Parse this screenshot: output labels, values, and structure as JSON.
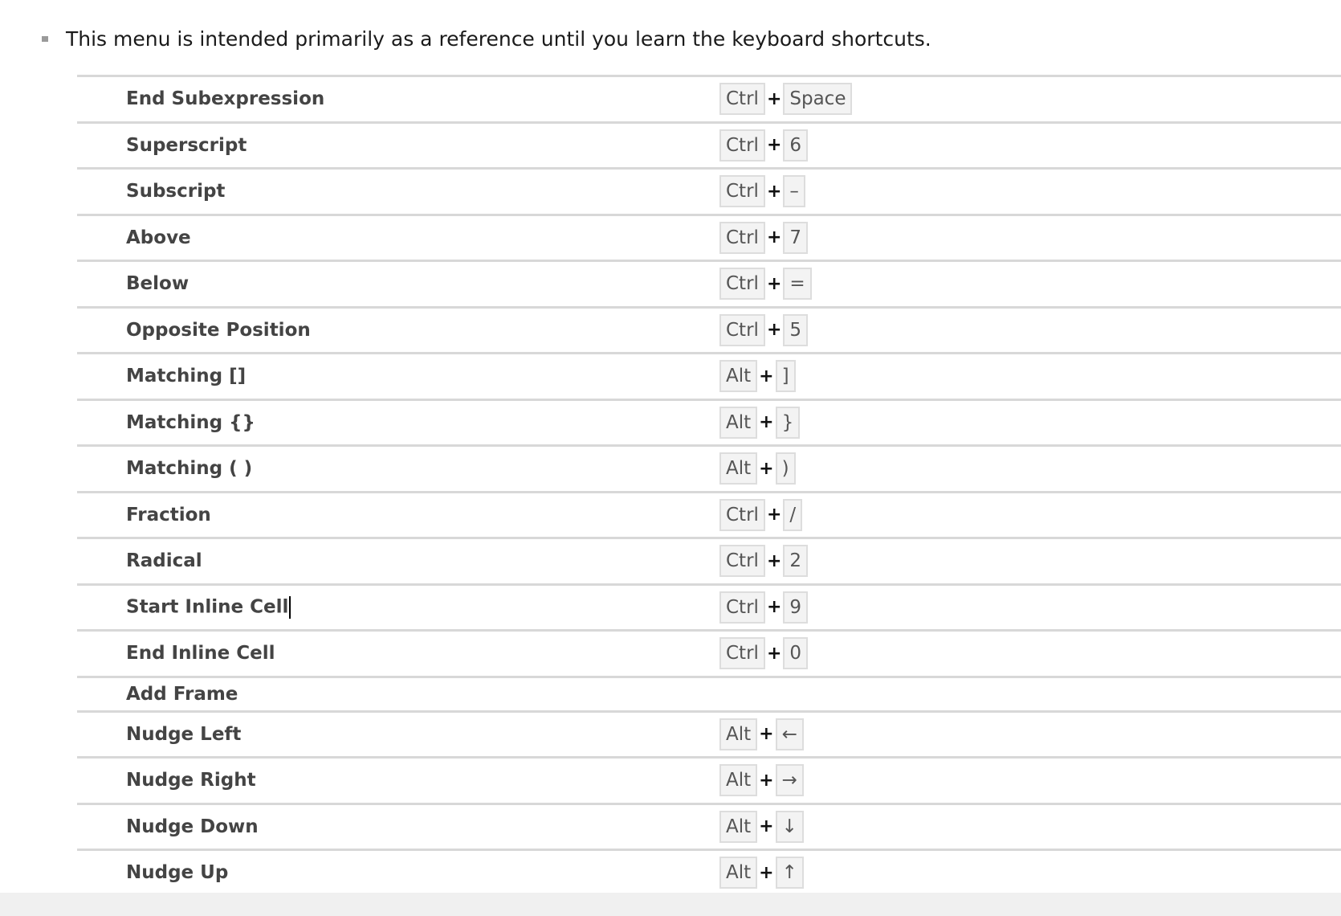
{
  "intro_text": "This menu is intended primarily as a reference until you learn the keyboard shortcuts.",
  "shortcuts": [
    {
      "label": "End Subexpression",
      "keys": [
        "Ctrl",
        "Space"
      ]
    },
    {
      "label": "Superscript",
      "keys": [
        "Ctrl",
        "6"
      ]
    },
    {
      "label": "Subscript",
      "keys": [
        "Ctrl",
        "–"
      ]
    },
    {
      "label": "Above",
      "keys": [
        "Ctrl",
        "7"
      ]
    },
    {
      "label": "Below",
      "keys": [
        "Ctrl",
        "="
      ]
    },
    {
      "label": "Opposite Position",
      "keys": [
        "Ctrl",
        "5"
      ]
    },
    {
      "label": "Matching []",
      "keys": [
        "Alt",
        "]"
      ]
    },
    {
      "label": "Matching {}",
      "keys": [
        "Alt",
        "}"
      ]
    },
    {
      "label": "Matching ( )",
      "keys": [
        "Alt",
        ")"
      ]
    },
    {
      "label": "Fraction",
      "keys": [
        "Ctrl",
        "/"
      ]
    },
    {
      "label": "Radical",
      "keys": [
        "Ctrl",
        "2"
      ]
    },
    {
      "label": "Start Inline Cell",
      "keys": [
        "Ctrl",
        "9"
      ]
    },
    {
      "label": "End Inline Cell",
      "keys": [
        "Ctrl",
        "0"
      ]
    },
    {
      "label": "Add Frame",
      "keys": []
    },
    {
      "label": "Nudge Left",
      "keys": [
        "Alt",
        "←"
      ]
    },
    {
      "label": "Nudge Right",
      "keys": [
        "Alt",
        "→"
      ]
    },
    {
      "label": "Nudge Down",
      "keys": [
        "Alt",
        "↓"
      ]
    },
    {
      "label": "Nudge Up",
      "keys": [
        "Alt",
        "↑"
      ]
    }
  ],
  "plus_sign": "+"
}
